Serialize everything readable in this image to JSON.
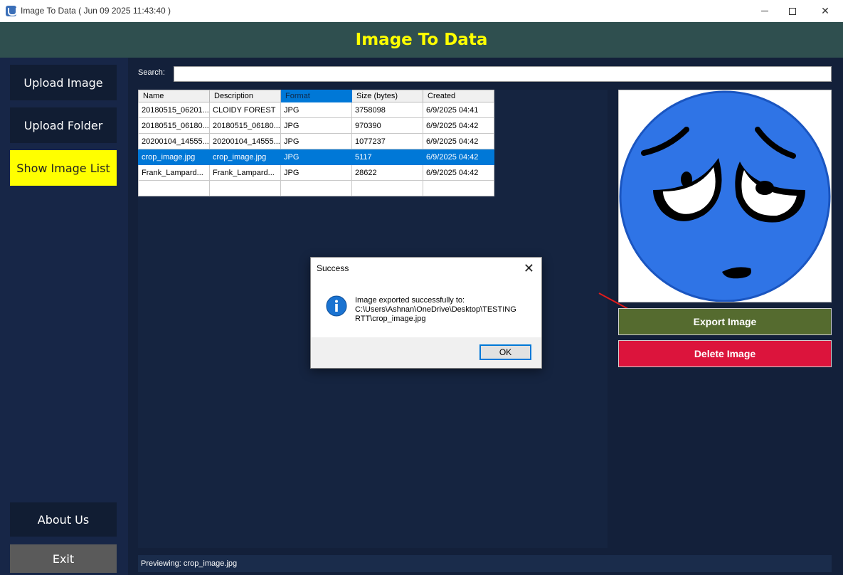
{
  "window": {
    "title": "Image To Data ( Jun 09 2025 11:43:40 )",
    "minimize_icon": "minimize-icon",
    "maximize_icon": "maximize-icon",
    "close_glyph": "✕"
  },
  "header": {
    "title": "Image To Data"
  },
  "sidebar": {
    "upload_image": "Upload Image",
    "upload_folder": "Upload Folder",
    "show_image_list": "Show Image List",
    "about_us": "About Us",
    "exit": "Exit",
    "active_color": "#ffff00"
  },
  "search": {
    "label": "Search:",
    "value": ""
  },
  "table": {
    "columns": [
      "Name",
      "Description",
      "Format",
      "Size (bytes)",
      "Created"
    ],
    "sorted_column": 2,
    "rows": [
      [
        "20180515_06201...",
        "CLOIDY FOREST",
        "JPG",
        "3758098",
        "6/9/2025 04:41"
      ],
      [
        "20180515_06180...",
        "20180515_06180...",
        "JPG",
        "970390",
        "6/9/2025 04:42"
      ],
      [
        "20200104_14555...",
        "20200104_14555...",
        "JPG",
        "1077237",
        "6/9/2025 04:42"
      ],
      [
        "crop_image.jpg",
        "crop_image.jpg",
        "JPG",
        "5117",
        "6/9/2025 04:42"
      ],
      [
        "Frank_Lampard...",
        "Frank_Lampard...",
        "JPG",
        "28622",
        "6/9/2025 04:42"
      ]
    ],
    "selected_row": 3
  },
  "preview": {
    "image": "sad-blue-emoji",
    "export_label": "Export Image",
    "delete_label": "Delete Image",
    "export_color": "#556b2f",
    "delete_color": "#dc143c"
  },
  "status": {
    "text": "Previewing: crop_image.jpg"
  },
  "dialog": {
    "title": "Success",
    "icon": "info-icon",
    "message": "Image exported successfully to:\nC:\\Users\\Ashnan\\OneDrive\\Desktop\\TESTING RTT\\crop_image.jpg",
    "ok_label": "OK"
  }
}
